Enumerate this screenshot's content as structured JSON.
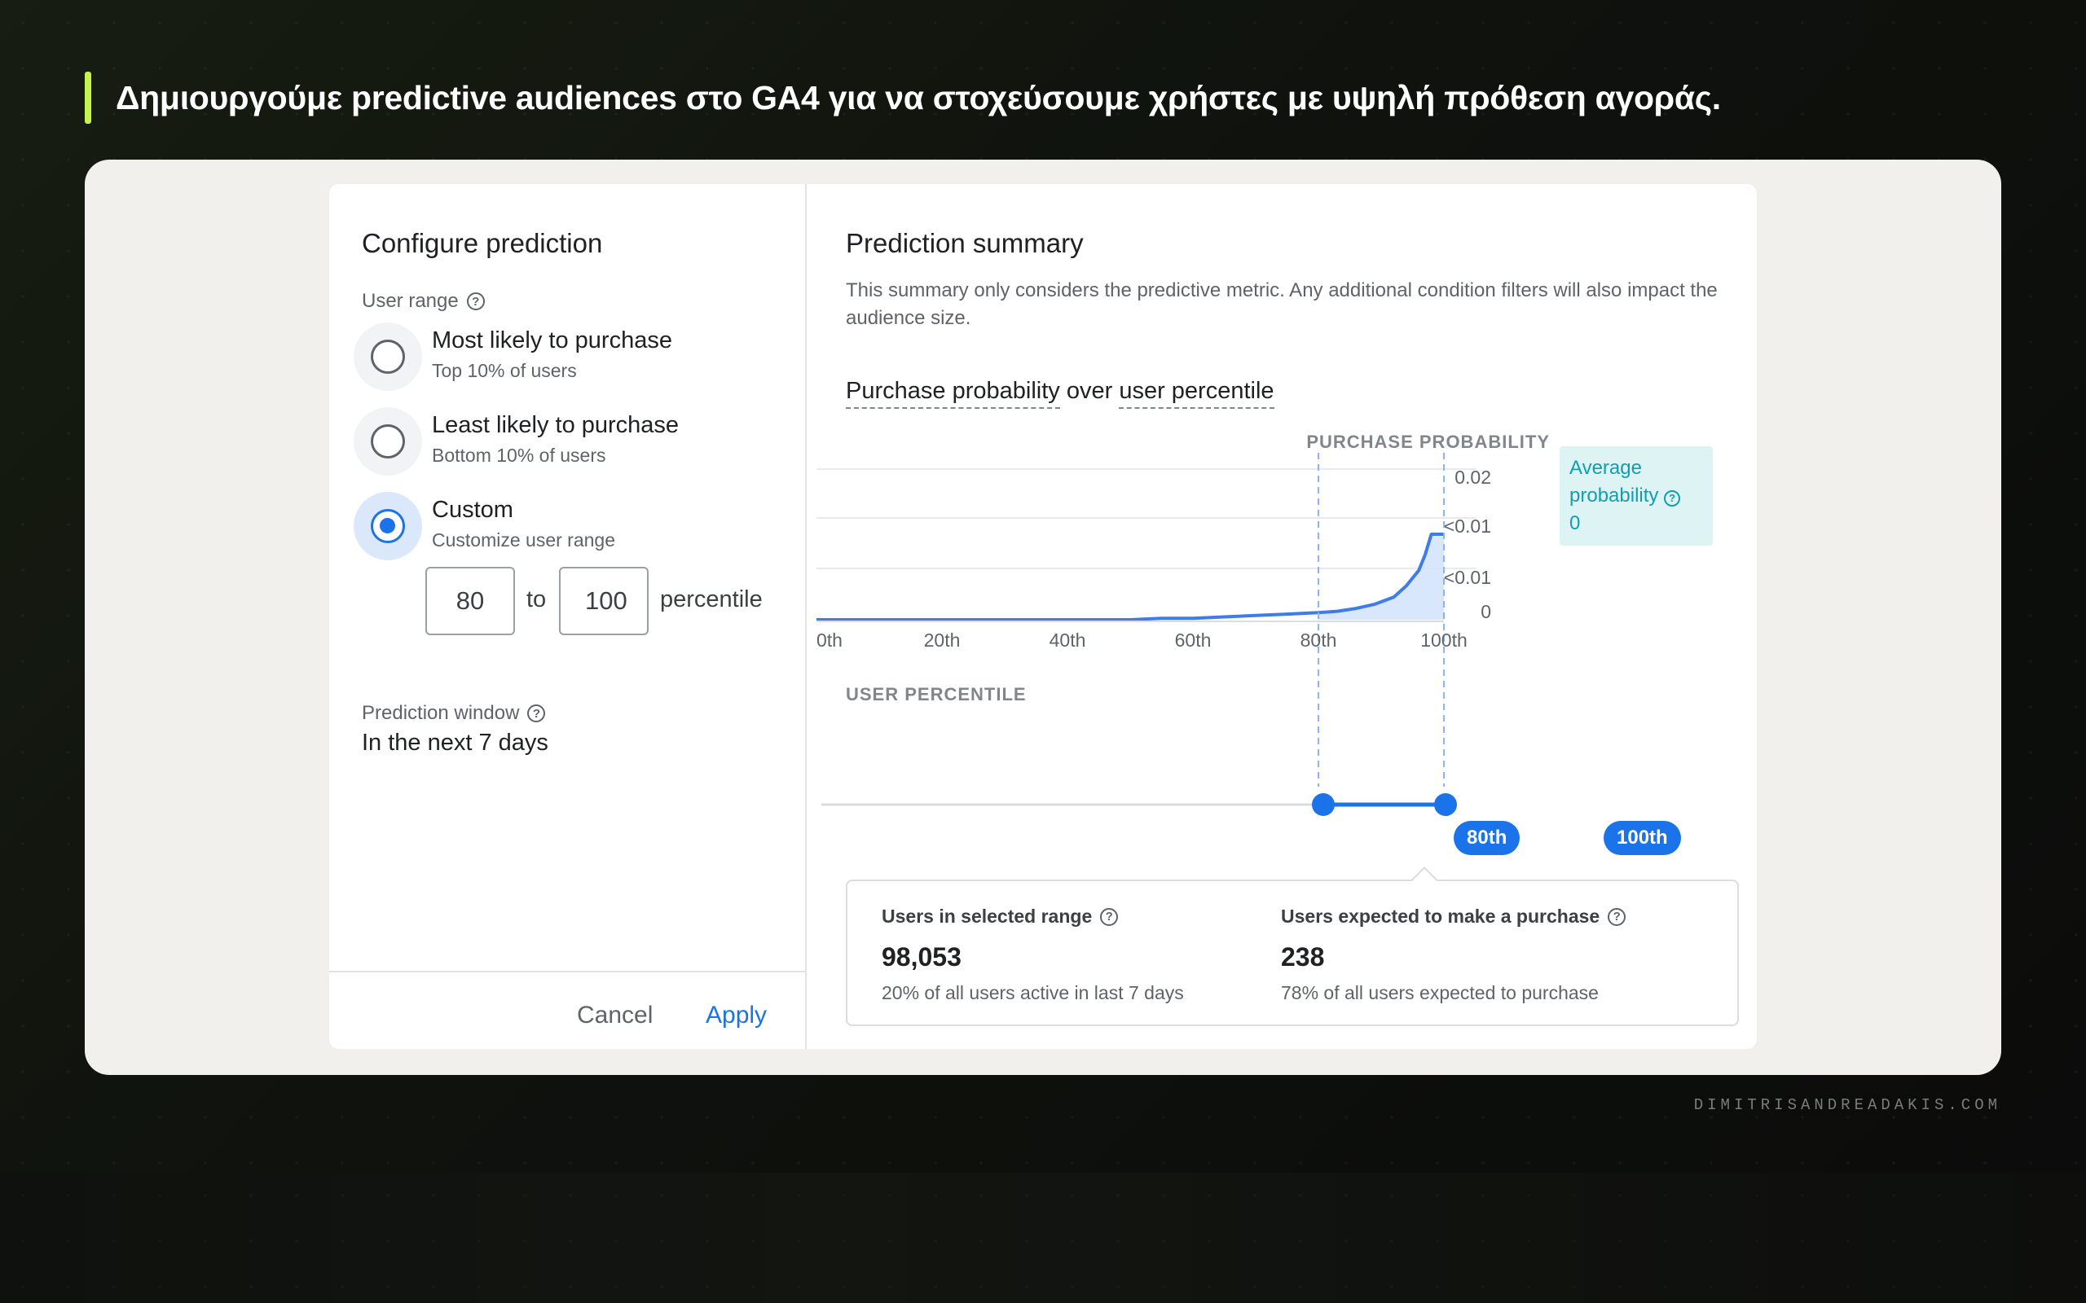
{
  "headline": "Δημιουργούμε predictive audiences στο GA4 για να στοχεύσουμε χρήστες με υψηλή πρόθεση αγοράς.",
  "configure": {
    "title": "Configure prediction",
    "user_range_label": "User range",
    "options": [
      {
        "title": "Most likely to purchase",
        "subtitle": "Top 10% of users",
        "selected": false
      },
      {
        "title": "Least likely to purchase",
        "subtitle": "Bottom 10% of users",
        "selected": false
      },
      {
        "title": "Custom",
        "subtitle": "Customize user range",
        "selected": true
      }
    ],
    "range_from": "80",
    "range_to_label": "to",
    "range_to": "100",
    "range_unit": "percentile",
    "prediction_window_label": "Prediction window",
    "prediction_window_value": "In the next 7 days",
    "cancel": "Cancel",
    "apply": "Apply"
  },
  "summary": {
    "title": "Prediction summary",
    "description": "This summary only considers the predictive metric. Any additional condition filters will also impact the audience size.",
    "chart_title_part1": "Purchase probability",
    "chart_title_over": "over",
    "chart_title_part2": "user percentile",
    "y_axis_caption": "PURCHASE PROBABILITY",
    "x_axis_caption": "USER PERCENTILE",
    "average_label": "Average probability",
    "average_value": "0",
    "slider_from_label": "80th",
    "slider_to_label": "100th",
    "stats": [
      {
        "label": "Users in selected range",
        "value": "98,053",
        "sub": "20% of all users active in last 7 days"
      },
      {
        "label": "Users expected to make a purchase",
        "value": "238",
        "sub": "78% of all users expected to purchase"
      }
    ]
  },
  "chart_data": {
    "type": "area",
    "x_tick_labels": [
      "0th",
      "20th",
      "40th",
      "60th",
      "80th",
      "100th"
    ],
    "y_tick_labels": [
      "0.02",
      "<0.01",
      "<0.01",
      "0"
    ],
    "xlabel": "USER PERCENTILE",
    "ylabel": "PURCHASE PROBABILITY",
    "xlim": [
      0,
      100
    ],
    "ylim": [
      0,
      0.02
    ],
    "x": [
      0,
      10,
      20,
      30,
      40,
      50,
      55,
      60,
      65,
      70,
      75,
      80,
      83,
      86,
      89,
      92,
      94,
      96,
      97,
      98,
      99,
      100
    ],
    "y": [
      0,
      0,
      0,
      0,
      0,
      0,
      0.0001,
      0.0001,
      0.0002,
      0.0003,
      0.0004,
      0.0005,
      0.0006,
      0.0008,
      0.0011,
      0.0016,
      0.0024,
      0.0035,
      0.0046,
      0.0064,
      0.0095,
      0.0098
    ],
    "highlight_range": [
      80,
      100
    ],
    "colors": {
      "line": "#3f7ce8",
      "fill": "#d2e3fc",
      "marker": "#1a73e8"
    },
    "grid": true,
    "legend": "none"
  }
}
